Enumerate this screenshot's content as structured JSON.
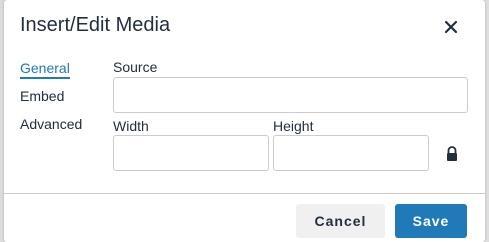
{
  "dialog": {
    "title": "Insert/Edit Media",
    "close_icon": "close-icon"
  },
  "nav": {
    "items": [
      {
        "label": "General",
        "active": true
      },
      {
        "label": "Embed",
        "active": false
      },
      {
        "label": "Advanced",
        "active": false
      }
    ]
  },
  "form": {
    "source_label": "Source",
    "source_value": "",
    "width_label": "Width",
    "width_value": "",
    "height_label": "Height",
    "height_value": "",
    "lock_icon": "lock-icon"
  },
  "footer": {
    "cancel_label": "Cancel",
    "save_label": "Save"
  },
  "colors": {
    "accent": "#207ab7",
    "text": "#222f3e",
    "border": "#cccccc",
    "secondary_button": "#f0f0f0"
  }
}
